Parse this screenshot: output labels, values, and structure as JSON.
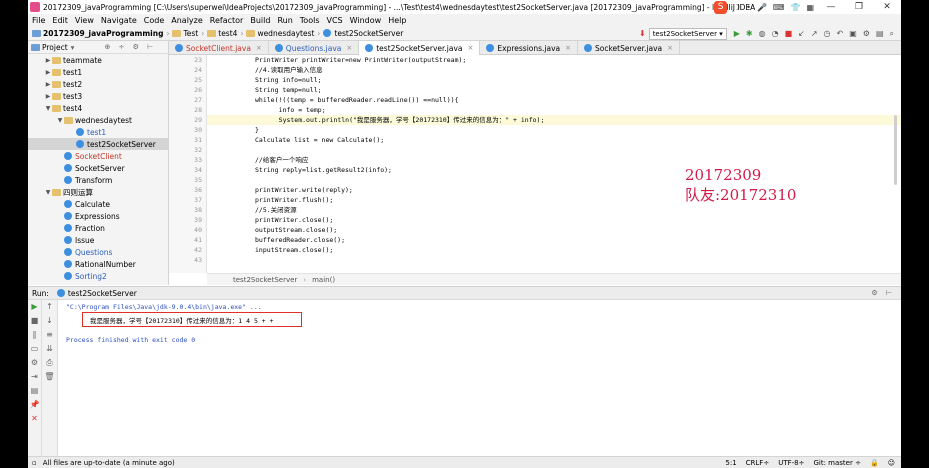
{
  "window": {
    "title": "20172309_javaProgramming [C:\\Users\\superwei\\IdeaProjects\\20172309_javaProgramming] - ...\\Test\\test4\\wednesdaytest\\test2SocketServer.java [20172309_javaProgramming] - IntelliJ IDEA",
    "ime_label": "S",
    "minimize": "—",
    "restore": "❐",
    "close": "✕"
  },
  "menu": [
    "File",
    "Edit",
    "View",
    "Navigate",
    "Code",
    "Analyze",
    "Refactor",
    "Build",
    "Run",
    "Tools",
    "VCS",
    "Window",
    "Help"
  ],
  "breadcrumb": [
    "20172309_javaProgramming",
    "Test",
    "test4",
    "wednesdaytest",
    "test2SocketServer"
  ],
  "run_config": "test2SocketServer",
  "project": {
    "header": "Project",
    "tree": [
      {
        "label": "teammate",
        "indent": 1,
        "kind": "folder",
        "arrow": "▶"
      },
      {
        "label": "test1",
        "indent": 1,
        "kind": "folder",
        "arrow": "▶"
      },
      {
        "label": "test2",
        "indent": 1,
        "kind": "folder",
        "arrow": "▶"
      },
      {
        "label": "test3",
        "indent": 1,
        "kind": "folder",
        "arrow": "▶"
      },
      {
        "label": "test4",
        "indent": 1,
        "kind": "folder",
        "arrow": "▼"
      },
      {
        "label": "wednesdaytest",
        "indent": 2,
        "kind": "folder",
        "arrow": "▼"
      },
      {
        "label": "test1",
        "indent": 3,
        "kind": "class",
        "color": "blue"
      },
      {
        "label": "test2SocketServer",
        "indent": 3,
        "kind": "class",
        "color": "normal",
        "selected": true
      },
      {
        "label": "SocketClient",
        "indent": 2,
        "kind": "class",
        "color": "red"
      },
      {
        "label": "SocketServer",
        "indent": 2,
        "kind": "class",
        "color": "normal"
      },
      {
        "label": "Transform",
        "indent": 2,
        "kind": "class",
        "color": "normal"
      },
      {
        "label": "四则运算",
        "indent": 1,
        "kind": "folder",
        "arrow": "▼"
      },
      {
        "label": "Calculate",
        "indent": 2,
        "kind": "class",
        "color": "normal"
      },
      {
        "label": "Expressions",
        "indent": 2,
        "kind": "class",
        "color": "normal"
      },
      {
        "label": "Fraction",
        "indent": 2,
        "kind": "class",
        "color": "normal"
      },
      {
        "label": "Issue",
        "indent": 2,
        "kind": "class",
        "color": "normal"
      },
      {
        "label": "Questions",
        "indent": 2,
        "kind": "class",
        "color": "blue"
      },
      {
        "label": "RationalNumber",
        "indent": 2,
        "kind": "class",
        "color": "normal"
      },
      {
        "label": "Sorting2",
        "indent": 2,
        "kind": "class",
        "color": "blue"
      }
    ]
  },
  "tabs": [
    {
      "label": "SocketClient.java",
      "color": "red"
    },
    {
      "label": "Questions.java",
      "color": "blue"
    },
    {
      "label": "test2SocketServer.java",
      "color": "normal",
      "active": true
    },
    {
      "label": "Expressions.java",
      "color": "normal"
    },
    {
      "label": "SocketServer.java",
      "color": "normal"
    }
  ],
  "tab_close": "×",
  "line_numbers": [
    "23",
    "24",
    "25",
    "26",
    "27",
    "28",
    "29",
    "30",
    "31",
    "32",
    "33",
    "34",
    "35",
    "36",
    "37",
    "38",
    "39",
    "40",
    "41",
    "42",
    "43"
  ],
  "code_lines": [
    "PrintWriter printWriter=new PrintWriter(outputStream);",
    "//4.读取用户输入信息",
    "String info=null;",
    "String temp=null;",
    "while(!((temp = bufferedReader.readLine()) ==null)){",
    "    info = temp;",
    "    System.out.println(\"我是服务器，学号【20172310】传过来的信息为：\" + info);",
    "}",
    "Calculate list = new Calculate();",
    "",
    "//给客户一个响应",
    "String reply=list.getResult2(info);",
    "",
    "printWriter.write(reply);",
    "printWriter.flush();",
    "//5.关闭资源",
    "printWriter.close();",
    "outputStream.close();",
    "bufferedReader.close();",
    "inputStream.close();",
    ""
  ],
  "annotation": {
    "line1": "20172309",
    "line2": "队友:20172310"
  },
  "editor_breadcrumb": [
    "test2SocketServer",
    "main()"
  ],
  "run": {
    "label": "Run:",
    "tab": "test2SocketServer",
    "cmd_line": "\"C:\\Program Files\\Java\\jdk-9.0.4\\bin\\java.exe\" ...",
    "output_line": "我是服务器，学号【20172310】传过来的信息为：1 4 5 + +",
    "exit_line": "Process finished with exit code 0"
  },
  "status": {
    "message": "All files are up-to-date (a minute ago)",
    "position": "5:1",
    "line_sep": "CRLF÷",
    "encoding": "UTF-8÷",
    "git": "Git: master ÷"
  }
}
